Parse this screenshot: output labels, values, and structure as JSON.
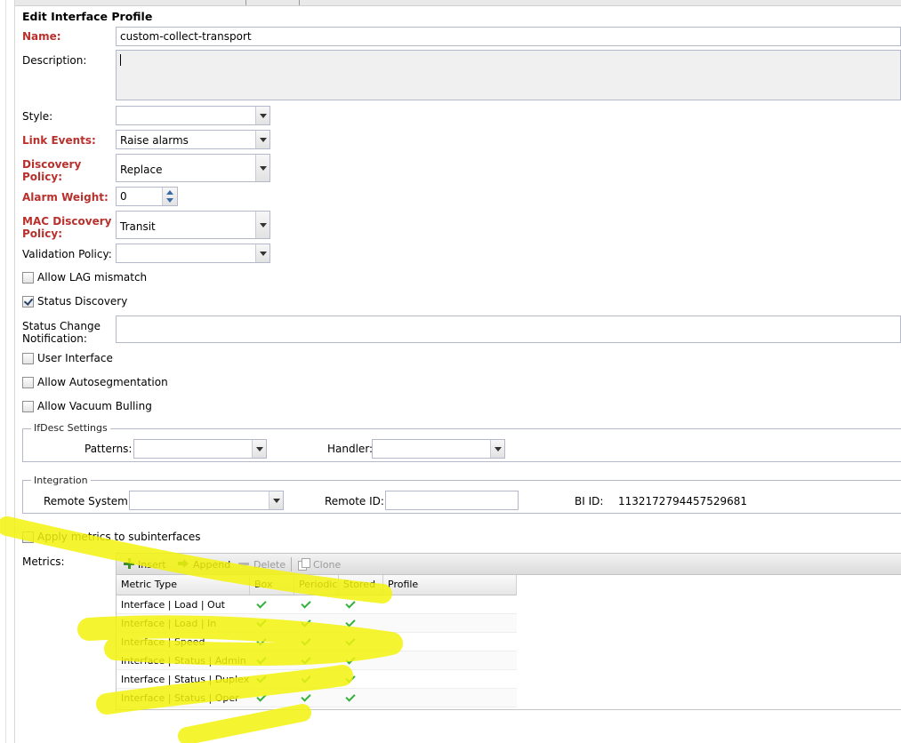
{
  "form": {
    "title": "Edit Interface Profile",
    "name": {
      "label": "Name:",
      "value": "custom-collect-transport"
    },
    "description": {
      "label": "Description:",
      "value": ""
    },
    "style": {
      "label": "Style:",
      "value": ""
    },
    "link_events": {
      "label": "Link Events:",
      "value": "Raise alarms"
    },
    "discovery_policy": {
      "label_1": "Discovery",
      "label_2": "Policy:",
      "value": "Replace"
    },
    "alarm_weight": {
      "label": "Alarm Weight:",
      "value": "0"
    },
    "mac_discovery_policy": {
      "label_1": "MAC Discovery",
      "label_2": "Policy:",
      "value": "Transit"
    },
    "validation_policy": {
      "label": "Validation Policy:",
      "value": ""
    },
    "allow_lag_mismatch": {
      "label": "Allow LAG mismatch",
      "checked": false
    },
    "status_discovery": {
      "label": "Status Discovery",
      "checked": true
    },
    "status_change_notification": {
      "label_1": "Status Change",
      "label_2": "Notification:",
      "value": ""
    },
    "user_interface": {
      "label": "User Interface",
      "checked": false
    },
    "allow_autosegmentation": {
      "label": "Allow Autosegmentation",
      "checked": false
    },
    "allow_vacuum_bulling": {
      "label": "Allow Vacuum Bulling",
      "checked": false
    },
    "ifdesc": {
      "legend": "IfDesc Settings",
      "patterns_label": "Patterns:",
      "patterns_value": "",
      "handler_label": "Handler:",
      "handler_value": ""
    },
    "integration": {
      "legend": "Integration",
      "remote_system_label": "Remote System:",
      "remote_system_value": "",
      "remote_id_label": "Remote ID:",
      "remote_id_value": "",
      "bi_id_label": "BI ID:",
      "bi_id_value": "1132172794457529681"
    },
    "apply_metrics": {
      "label": "Apply metrics to subinterfaces",
      "checked": false
    },
    "metrics": {
      "label": "Metrics:",
      "toolbar": {
        "insert": "Insert",
        "append": "Append",
        "delete": "Delete",
        "clone": "Clone"
      },
      "columns": [
        "Metric Type",
        "Box",
        "Periodic",
        "Stored",
        "Profile"
      ],
      "rows": [
        {
          "metric_type": "Interface | Load | Out",
          "box": true,
          "periodic": true,
          "stored": true,
          "profile": ""
        },
        {
          "metric_type": "Interface | Load | In",
          "box": true,
          "periodic": true,
          "stored": true,
          "profile": ""
        },
        {
          "metric_type": "Interface | Speed",
          "box": true,
          "periodic": true,
          "stored": true,
          "profile": ""
        },
        {
          "metric_type": "Interface | Status | Admin",
          "box": true,
          "periodic": true,
          "stored": true,
          "profile": ""
        },
        {
          "metric_type": "Interface | Status | Duplex",
          "box": true,
          "periodic": true,
          "stored": true,
          "profile": ""
        },
        {
          "metric_type": "Interface | Status | Oper",
          "box": true,
          "periodic": true,
          "stored": true,
          "profile": ""
        }
      ]
    }
  },
  "colors": {
    "required_label": "#b8312d",
    "check": "#34b13a",
    "highlighter": "#f2f20d"
  }
}
